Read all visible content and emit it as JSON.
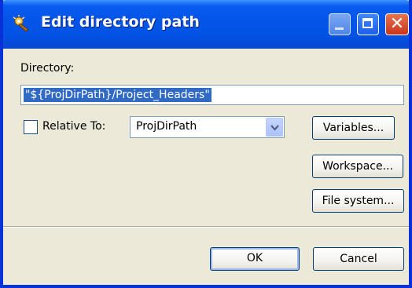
{
  "window": {
    "title": "Edit directory path",
    "icon": "project-wizard-icon",
    "controls": [
      "minimize",
      "maximize",
      "close"
    ]
  },
  "form": {
    "directory_label": "Directory:",
    "directory_value": "\"${ProjDirPath}/Project_Headers\"",
    "relative_checkbox_checked": false,
    "relative_label": "Relative To:",
    "relative_selected": "ProjDirPath"
  },
  "buttons": {
    "variables": "Variables...",
    "workspace": "Workspace...",
    "file_system": "File system...",
    "ok": "OK",
    "cancel": "Cancel"
  },
  "colors": {
    "titlebar": "#0454e8",
    "selection": "#316ac5",
    "dialog_bg": "#ece9d8"
  }
}
